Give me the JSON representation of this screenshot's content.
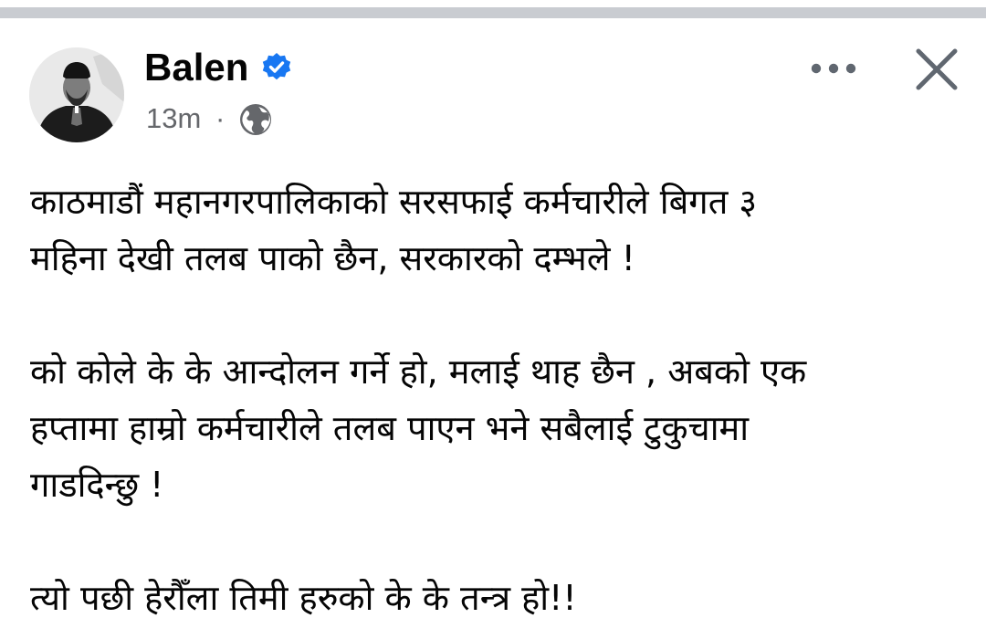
{
  "post": {
    "author": {
      "name": "Balen",
      "verified_icon": "verified-badge-icon",
      "avatar": "profile-photo"
    },
    "meta": {
      "time": "13m",
      "separator": "·",
      "audience_icon": "globe-icon"
    },
    "actions": {
      "more_icon": "more-options-icon",
      "close_icon": "close-icon"
    },
    "body": [
      {
        "lines": [
          "काठमाडौं महानगरपालिकाको सरसफाई कर्मचारीले बिगत ३",
          "महिना देखी तलब पाको छैन, सरकारको दम्भले !"
        ]
      },
      {
        "lines": [
          "को कोले के के आन्दोलन गर्ने हो, मलाई थाह छैन , अबको एक",
          "हप्तामा हाम्रो कर्मचारीले तलब पाएन भने सबैलाई टुकुचामा",
          "गाडदिन्छु !"
        ]
      },
      {
        "lines": [
          "त्यो पछी हेरौँला तिमी हरुको के के तन्त्र हो!!"
        ]
      }
    ],
    "colors": {
      "verified": "#1877f2",
      "meta_text": "#65676b",
      "icon": "#606770",
      "text": "#050505"
    }
  }
}
